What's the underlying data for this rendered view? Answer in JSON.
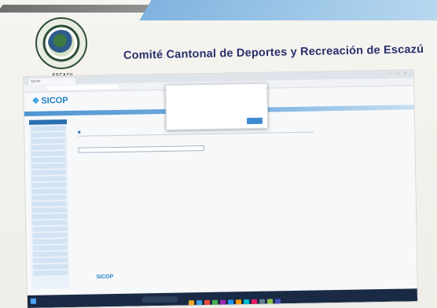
{
  "letterhead": {
    "org_title": "Comité Cantonal de Deportes y Recreación de Escazú",
    "logo_caption": "ESCAZU"
  },
  "browser": {
    "tab_label": "SICOP",
    "address": "",
    "window_controls": "– □ ×"
  },
  "app": {
    "brand_name": "SICOP",
    "header_strip": "",
    "sidebar_title": "",
    "sidebar_items": [
      "",
      "",
      "",
      "",
      "",
      "",
      "",
      "",
      "",
      "",
      "",
      "",
      "",
      "",
      "",
      "",
      "",
      "",
      "",
      "",
      "",
      "",
      "",
      ""
    ],
    "content_title": "",
    "search_label": "",
    "row_text": "",
    "row_right_text": ""
  },
  "dialog": {
    "title": "",
    "message": "",
    "ok_label": ""
  },
  "footer": {
    "brand_name": "SICOP",
    "line": "",
    "small": ""
  },
  "taskbar": {
    "search_placeholder": "",
    "clock": "",
    "icon_colors": [
      "#f5a623",
      "#3aa0e0",
      "#e94b3c",
      "#4caf50",
      "#9c27b0",
      "#2196f3",
      "#ff9800",
      "#00bcd4",
      "#e91e63",
      "#607d8b",
      "#8bc34a",
      "#3f51b5"
    ]
  }
}
